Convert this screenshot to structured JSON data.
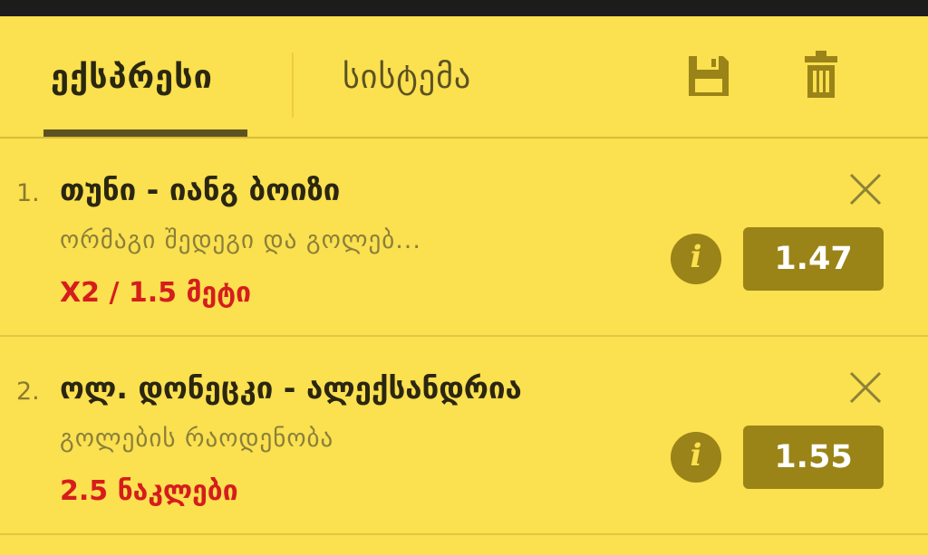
{
  "tabs": {
    "express": "ექსპრესი",
    "system": "სისტემა"
  },
  "icons": {
    "save": "save-icon",
    "trash": "trash-icon",
    "close": "close-icon",
    "info": "info-icon"
  },
  "colors": {
    "background": "#fbe04f",
    "odds_button": "#9a8418",
    "selection_text": "#d51d1d"
  },
  "bets": [
    {
      "number": "1.",
      "match": "თუნი - იანგ ბოიზი",
      "market": "ორმაგი შედეგი და გოლებ...",
      "selection": "X2 / 1.5 მეტი",
      "info": "i",
      "odds": "1.47"
    },
    {
      "number": "2.",
      "match": "ოლ. დონეცკი - ალექსანდრია",
      "market": "გოლების რაოდენობა",
      "selection": "2.5 ნაკლები",
      "info": "i",
      "odds": "1.55"
    }
  ]
}
